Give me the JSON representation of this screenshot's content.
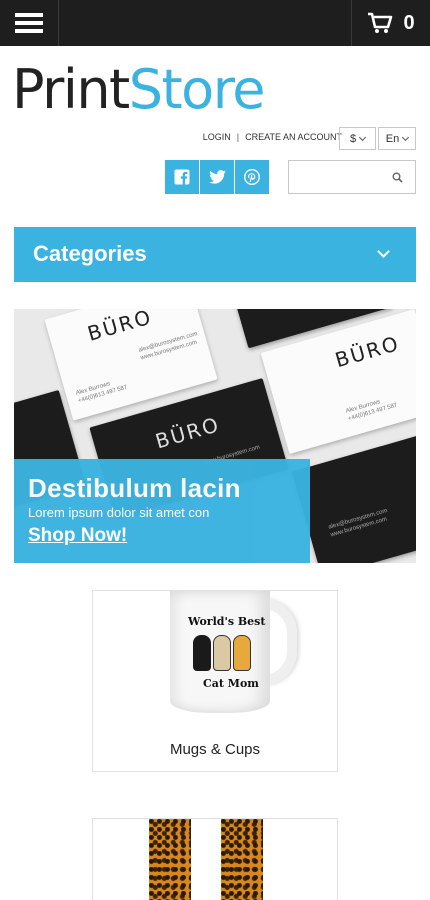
{
  "header": {
    "menu_icon": "hamburger-menu-icon",
    "cart_icon": "shopping-cart-icon",
    "cart_count": "0"
  },
  "logo": {
    "part1": "Print",
    "part2": "Store"
  },
  "account": {
    "login": "LOGIN",
    "separator": "|",
    "create_account": "CREATE AN ACCOUNT",
    "currency": "$",
    "language": "En"
  },
  "social": {
    "icons": [
      "facebook-icon",
      "twitter-icon",
      "pinterest-icon"
    ]
  },
  "search": {
    "placeholder": "",
    "value": ""
  },
  "categories": {
    "title": "Categories"
  },
  "banner": {
    "title": "Destibulum lacin",
    "subtitle": "Lorem ipsum dolor sit amet con",
    "link": "Shop Now!",
    "card_brand": "BÜRO",
    "card_name": "Alex Burrows",
    "card_phone": "+44(0)613 497 587",
    "card_email": "alex@burosystem.com",
    "card_web": "www.burosystem.com"
  },
  "products": [
    {
      "label": "Mugs & Cups",
      "mug_line1": "World's Best",
      "mug_line2": "Cat Mom"
    },
    {
      "label": ""
    }
  ],
  "colors": {
    "accent": "#3bb3e0",
    "topbar": "#1e1e1e"
  }
}
